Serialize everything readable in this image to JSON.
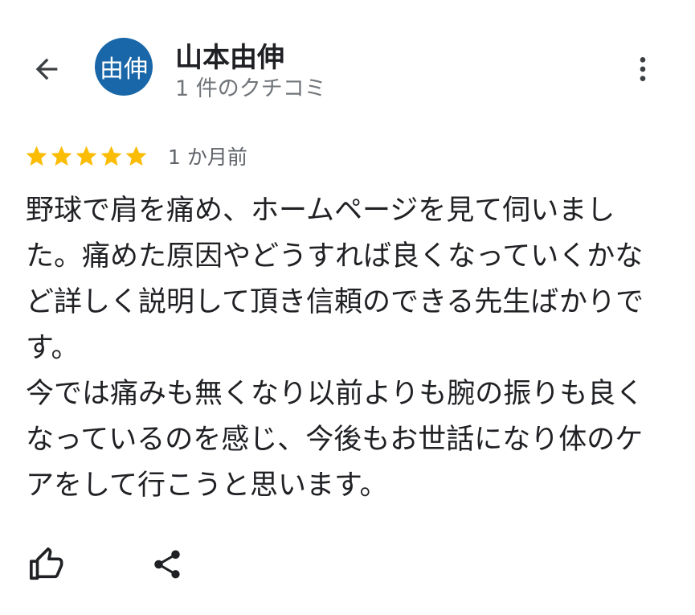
{
  "header": {
    "reviewer_name": "山本由伸",
    "avatar_text": "由伸",
    "avatar_color": "#1967a8",
    "review_count": "1 件のクチコミ",
    "back_icon": "arrow-back-icon",
    "more_icon": "more-vert-icon"
  },
  "review": {
    "rating": 5,
    "rating_max": 5,
    "star_color": "#fbbc04",
    "time": "1 か月前",
    "paragraphs": [
      "野球で肩を痛め、ホームページを見て伺いました。痛めた原因やどうすれば良くなっていくかなど詳しく説明して頂き信頼のできる先生ばかりです。",
      "今では痛みも無くなり以前よりも腕の振りも良くなっているのを感じ、今後もお世話になり体のケアをして行こうと思います。"
    ]
  },
  "actions": {
    "like_icon": "thumb-up-icon",
    "share_icon": "share-icon"
  }
}
